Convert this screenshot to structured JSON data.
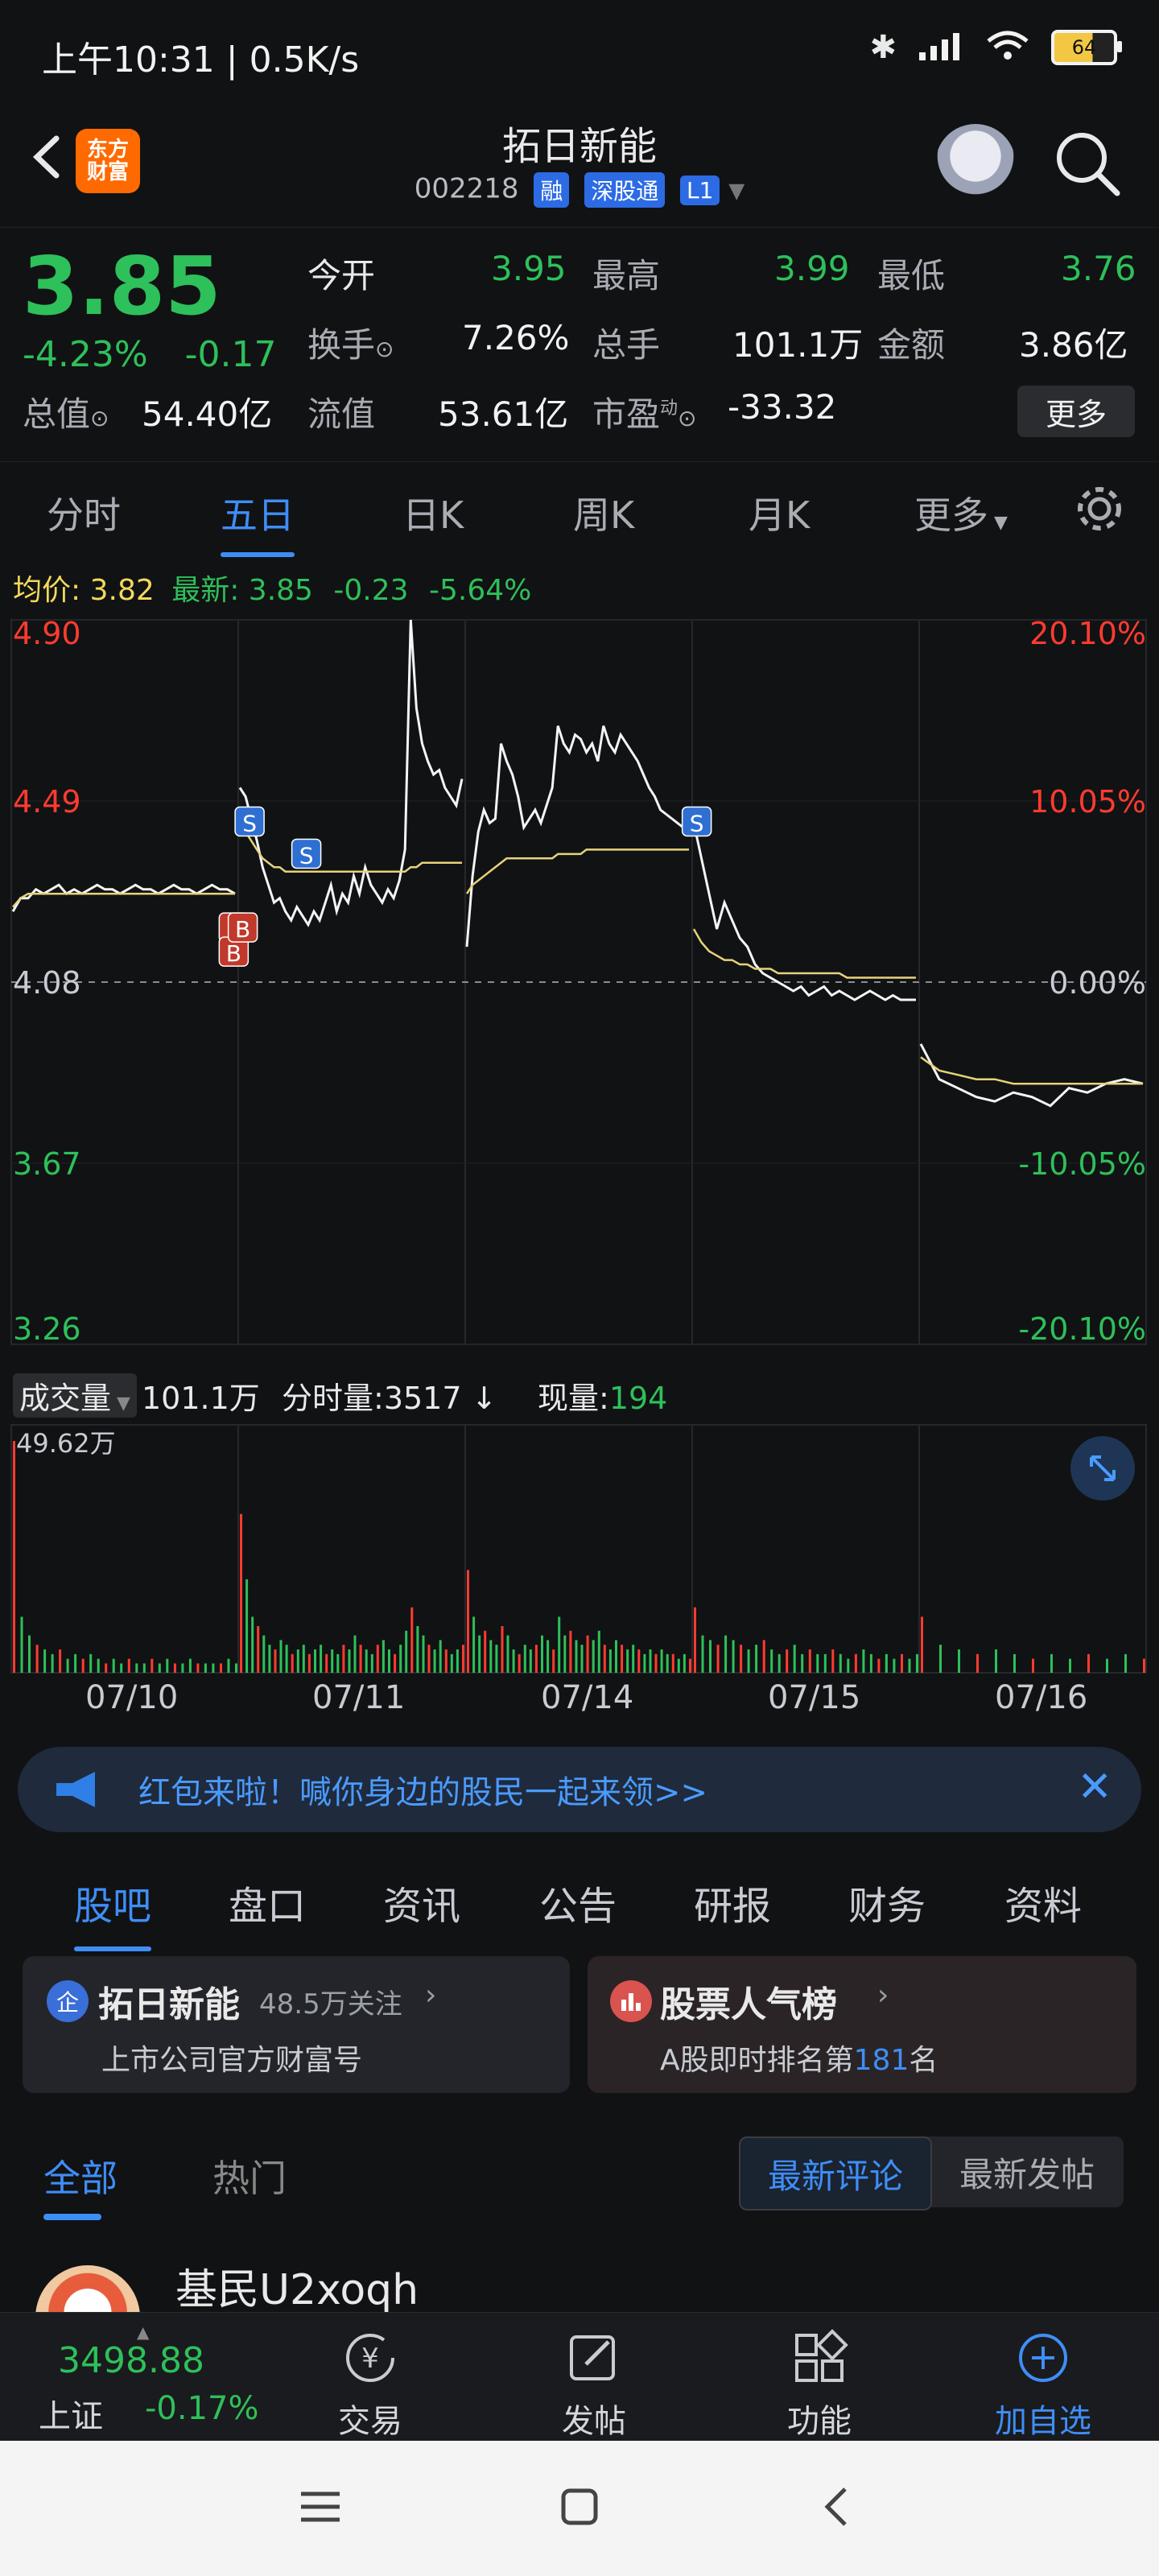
{
  "status": {
    "time_speed": "上午10:31 | 0.5K/s",
    "battery": "64"
  },
  "header": {
    "logo": "东方\n财富",
    "title": "拓日新能",
    "code": "002218",
    "badges": [
      "融",
      "深股通",
      "L1"
    ]
  },
  "quote": {
    "price": "3.85",
    "change_pct": "-4.23%",
    "change": "-0.17",
    "today_open_label": "今开",
    "today_open": "3.95",
    "high_label": "最高",
    "high": "3.99",
    "low_label": "最低",
    "low": "3.76",
    "turnover_label": "换手",
    "turnover": "7.26%",
    "total_hands_label": "总手",
    "total_hands": "101.1万",
    "amount_label": "金额",
    "amount": "3.86亿",
    "mktcap_label": "总值",
    "mktcap": "54.40亿",
    "float_label": "流值",
    "float_value": "53.61亿",
    "pe_label": "市盈",
    "pe_sup": "动",
    "pe": "-33.32",
    "more": "更多"
  },
  "chart_tabs": [
    "分时",
    "五日",
    "日K",
    "周K",
    "月K",
    "更多"
  ],
  "chart_active_tab": "五日",
  "avg_line": {
    "avg_label": "均价:",
    "avg": "3.82",
    "latest_label": "最新:",
    "latest": "3.85",
    "chg": "-0.23",
    "chg_pct": "-5.64%"
  },
  "chart_data": {
    "type": "line",
    "title": "",
    "x_days": [
      "07/10",
      "07/11",
      "07/14",
      "07/15",
      "07/16"
    ],
    "y_left_ticks": [
      "4.90",
      "4.49",
      "4.08",
      "3.67",
      "3.26"
    ],
    "y_right_ticks": [
      "20.10%",
      "10.05%",
      "0.00%",
      "-10.05%",
      "-20.10%"
    ],
    "ylim": [
      3.26,
      4.9
    ],
    "prev_close": 4.08,
    "series": [
      {
        "values": [
          [
            4.24,
            4.27,
            4.27,
            4.29,
            4.28,
            4.29,
            4.3,
            4.28,
            4.29,
            4.28,
            4.29,
            4.3,
            4.29,
            4.29,
            4.28,
            4.29,
            4.3,
            4.29,
            4.29,
            4.28,
            4.29,
            4.3,
            4.29,
            4.29,
            4.28,
            4.29,
            4.3,
            4.29,
            4.29,
            4.28
          ],
          [
            4.52,
            4.5,
            4.45,
            4.4,
            4.34,
            4.3,
            4.26,
            4.27,
            4.24,
            4.22,
            4.25,
            4.23,
            4.21,
            4.24,
            4.22,
            4.26,
            4.3,
            4.24,
            4.28,
            4.26,
            4.32,
            4.28,
            4.34,
            4.3,
            4.28,
            4.26,
            4.29,
            4.27,
            4.31,
            4.38,
            4.9,
            4.7,
            4.62,
            4.58,
            4.55,
            4.56,
            4.52,
            4.5,
            4.48,
            4.54
          ],
          [
            4.16,
            4.32,
            4.42,
            4.47,
            4.44,
            4.45,
            4.62,
            4.58,
            4.55,
            4.5,
            4.43,
            4.45,
            4.47,
            4.44,
            4.48,
            4.52,
            4.66,
            4.62,
            4.6,
            4.64,
            4.63,
            4.6,
            4.62,
            4.58,
            4.66,
            4.62,
            4.6,
            4.64,
            4.62,
            4.6,
            4.58,
            4.55,
            4.52,
            4.5,
            4.47,
            4.46,
            4.45,
            4.44,
            4.43,
            4.42
          ],
          [
            4.44,
            4.36,
            4.28,
            4.2,
            4.26,
            4.22,
            4.18,
            4.16,
            4.12,
            4.1,
            4.09,
            4.08,
            4.07,
            4.06,
            4.07,
            4.05,
            4.06,
            4.07,
            4.05,
            4.06,
            4.05,
            4.04,
            4.05,
            4.06,
            4.05,
            4.04,
            4.05,
            4.04,
            4.04,
            4.04
          ],
          [
            3.94,
            3.86,
            3.84,
            3.82,
            3.81,
            3.83,
            3.82,
            3.8,
            3.84,
            3.83,
            3.85,
            3.86,
            3.85
          ]
        ]
      },
      {
        "name": "均价",
        "values": [
          [
            4.25,
            4.27,
            4.28,
            4.28,
            4.28,
            4.28,
            4.28,
            4.28,
            4.28,
            4.28,
            4.28,
            4.28,
            4.28,
            4.28,
            4.28,
            4.28,
            4.28,
            4.28,
            4.28,
            4.28,
            4.28,
            4.28,
            4.28,
            4.28,
            4.28,
            4.28,
            4.28,
            4.28,
            4.28,
            4.28
          ],
          [
            4.45,
            4.42,
            4.4,
            4.38,
            4.36,
            4.35,
            4.34,
            4.34,
            4.33,
            4.33,
            4.33,
            4.33,
            4.33,
            4.33,
            4.33,
            4.33,
            4.33,
            4.33,
            4.33,
            4.33,
            4.33,
            4.33,
            4.33,
            4.33,
            4.33,
            4.33,
            4.33,
            4.33,
            4.33,
            4.33,
            4.34,
            4.34,
            4.35,
            4.35,
            4.35,
            4.35,
            4.35,
            4.35,
            4.35,
            4.35
          ],
          [
            4.28,
            4.3,
            4.31,
            4.32,
            4.33,
            4.34,
            4.35,
            4.36,
            4.36,
            4.36,
            4.36,
            4.36,
            4.36,
            4.36,
            4.36,
            4.36,
            4.37,
            4.37,
            4.37,
            4.37,
            4.37,
            4.38,
            4.38,
            4.38,
            4.38,
            4.38,
            4.38,
            4.38,
            4.38,
            4.38,
            4.38,
            4.38,
            4.38,
            4.38,
            4.38,
            4.38,
            4.38,
            4.38,
            4.38,
            4.38
          ],
          [
            4.2,
            4.17,
            4.15,
            4.14,
            4.13,
            4.13,
            4.12,
            4.12,
            4.11,
            4.11,
            4.11,
            4.1,
            4.1,
            4.1,
            4.1,
            4.1,
            4.1,
            4.1,
            4.1,
            4.1,
            4.09,
            4.09,
            4.09,
            4.09,
            4.09,
            4.09,
            4.09,
            4.09,
            4.09,
            4.09
          ],
          [
            3.91,
            3.88,
            3.87,
            3.86,
            3.86,
            3.85,
            3.85,
            3.85,
            3.85,
            3.85,
            3.85,
            3.85,
            3.85
          ]
        ]
      }
    ],
    "markers": [
      {
        "day": 0,
        "pos": 0.98,
        "label": "B"
      },
      {
        "day": 0,
        "pos": 0.98,
        "label": "B"
      },
      {
        "day": 1,
        "pos": 0.02,
        "label": "B"
      },
      {
        "day": 1,
        "pos": 0.05,
        "label": "S"
      },
      {
        "day": 1,
        "pos": 0.3,
        "label": "S"
      },
      {
        "day": 3,
        "pos": 0.02,
        "label": "S"
      }
    ],
    "volume": {
      "max_label": "49.62万",
      "days": [
        [
          49.6,
          12,
          8,
          6,
          5,
          4,
          5,
          3,
          4,
          3,
          4,
          3,
          2,
          3,
          2,
          3,
          2,
          2,
          3,
          2,
          3,
          2,
          2,
          3,
          2,
          2,
          2,
          2,
          3,
          2
        ],
        [
          34,
          20,
          12,
          10,
          8,
          6,
          5,
          7,
          6,
          4,
          5,
          6,
          4,
          5,
          6,
          4,
          5,
          4,
          6,
          5,
          8,
          6,
          5,
          4,
          6,
          7,
          5,
          4,
          6,
          9,
          14,
          10,
          8,
          6,
          5,
          7,
          5,
          4,
          5,
          6
        ],
        [
          22,
          12,
          8,
          9,
          7,
          6,
          10,
          8,
          5,
          4,
          6,
          5,
          6,
          8,
          7,
          5,
          12,
          8,
          9,
          7,
          6,
          8,
          7,
          9,
          6,
          5,
          7,
          6,
          5,
          6,
          5,
          4,
          5,
          4,
          5,
          4,
          4,
          3,
          4,
          3
        ],
        [
          14,
          8,
          7,
          6,
          8,
          7,
          6,
          5,
          6,
          7,
          5,
          4,
          5,
          6,
          4,
          5,
          4,
          4,
          5,
          4,
          3,
          4,
          5,
          4,
          3,
          4,
          3,
          4,
          3,
          4
        ],
        [
          12,
          6,
          5,
          4,
          5,
          4,
          3,
          4,
          3,
          4,
          3,
          4,
          3
        ]
      ]
    }
  },
  "volume_head": {
    "select": "成交量",
    "total": "101.1万",
    "tick_label": "分时量:",
    "tick_val": "3517",
    "now_label": "现量:",
    "now_val": "194"
  },
  "banner": {
    "text": "红包来啦！喊你身边的股民一起来领>>"
  },
  "bottom_tabs": [
    "股吧",
    "盘口",
    "资讯",
    "公告",
    "研报",
    "财务",
    "资料"
  ],
  "bottom_active": "股吧",
  "cards": {
    "left_title": "拓日新能",
    "left_follow": "48.5万关注",
    "left_sub": "上市公司官方财富号",
    "left_badge": "企",
    "right_title": "股票人气榜",
    "right_sub_pre": "A股即时排名第",
    "right_rank": "181",
    "right_sub_post": "名"
  },
  "filter": {
    "all": "全部",
    "hot": "热门",
    "latest_comment": "最新评论",
    "latest_post": "最新发帖"
  },
  "post_user": "基民U2xoqh",
  "nav": {
    "index_value": "3498.88",
    "index_name": "上证",
    "index_change": "-0.17%",
    "trade": "交易",
    "post": "发帖",
    "func": "功能",
    "add": "加自选"
  }
}
